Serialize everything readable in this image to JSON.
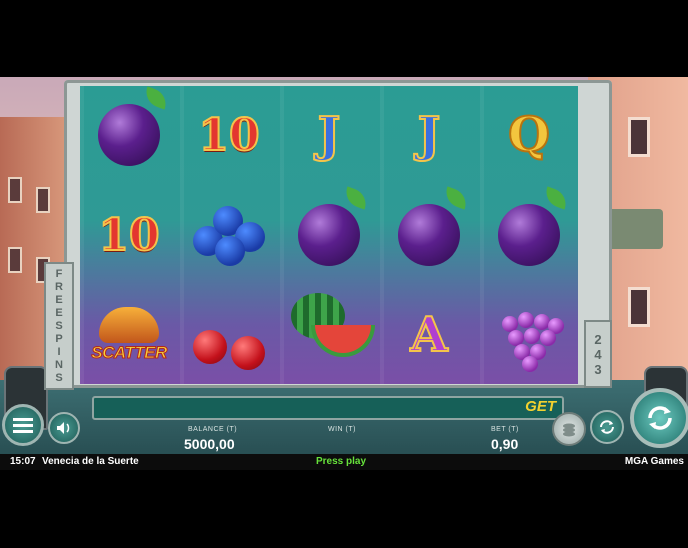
{
  "game": {
    "title": "Venecia de la Suerte",
    "provider": "MGA Games",
    "time": "15:07",
    "status": "Press play"
  },
  "reels": {
    "rows": [
      [
        "plum",
        "10",
        "J",
        "J",
        "Q"
      ],
      [
        "10",
        "blueberries",
        "plum",
        "plum",
        "plum"
      ],
      [
        "scatter",
        "cherries",
        "watermelon",
        "A",
        "grapes"
      ]
    ],
    "scatter_label": "SCATTER",
    "ten_label": "10",
    "j_label": "J",
    "q_label": "Q",
    "a_label": "A"
  },
  "side": {
    "freespins_label": "FREESPINS",
    "ways": "243"
  },
  "bar": {
    "get_label": "GET"
  },
  "meters": {
    "balance_label": "BALANCE (T)",
    "balance_value": "5000,00",
    "win_label": "WIN (T)",
    "win_value": "",
    "bet_label": "BET (T)",
    "bet_value": "0,90"
  },
  "colors": {
    "reel_top": "#2b9c94",
    "reel_bottom": "#7a4fa7",
    "press_play": "#67e23b",
    "get_text": "#f2d12f"
  },
  "icons": {
    "menu": "menu-icon",
    "sound": "speaker-icon",
    "bet": "coin-stack-icon",
    "autoplay": "autoplay-icon",
    "spin": "spin-arrows-icon"
  }
}
